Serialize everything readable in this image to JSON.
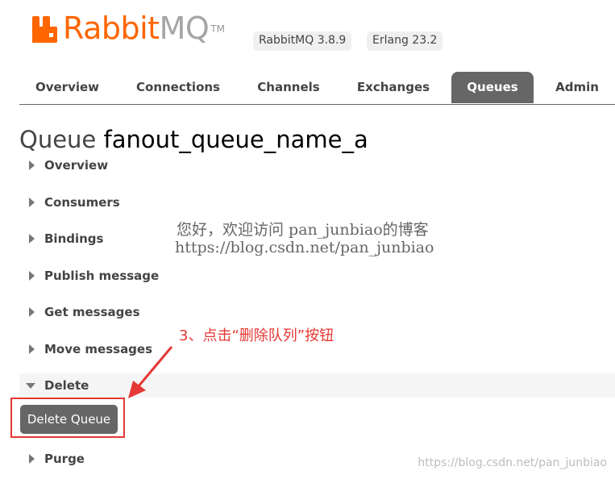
{
  "brand": {
    "logo_word": "Rabbit",
    "logo_suffix": "MQ",
    "trademark": "TM",
    "badges": [
      "RabbitMQ 3.8.9",
      "Erlang 23.2"
    ]
  },
  "tabs": [
    {
      "label": "Overview",
      "active": false
    },
    {
      "label": "Connections",
      "active": false
    },
    {
      "label": "Channels",
      "active": false
    },
    {
      "label": "Exchanges",
      "active": false
    },
    {
      "label": "Queues",
      "active": true
    },
    {
      "label": "Admin",
      "active": false
    }
  ],
  "page": {
    "title_prefix": "Queue",
    "queue_name": "fanout_queue_name_a"
  },
  "sections": [
    {
      "label": "Overview",
      "expanded": false
    },
    {
      "label": "Consumers",
      "expanded": false
    },
    {
      "label": "Bindings",
      "expanded": false
    },
    {
      "label": "Publish message",
      "expanded": false
    },
    {
      "label": "Get messages",
      "expanded": false
    },
    {
      "label": "Move messages",
      "expanded": false
    },
    {
      "label": "Delete",
      "expanded": true
    },
    {
      "label": "Purge",
      "expanded": false
    }
  ],
  "delete_button": {
    "label": "Delete Queue"
  },
  "watermark": {
    "line1": "您好，欢迎访问 pan_junbiao的博客",
    "line2": "https://blog.csdn.net/pan_junbiao"
  },
  "annotation": {
    "text": "3、点击“删除队列”按钮",
    "color": "#e53935"
  },
  "csdn_watermark": "https://blog.csdn.net/pan_junbiao",
  "colors": {
    "brand_orange": "#ff6600",
    "tab_active_bg": "#666666",
    "button_bg": "#666666"
  }
}
